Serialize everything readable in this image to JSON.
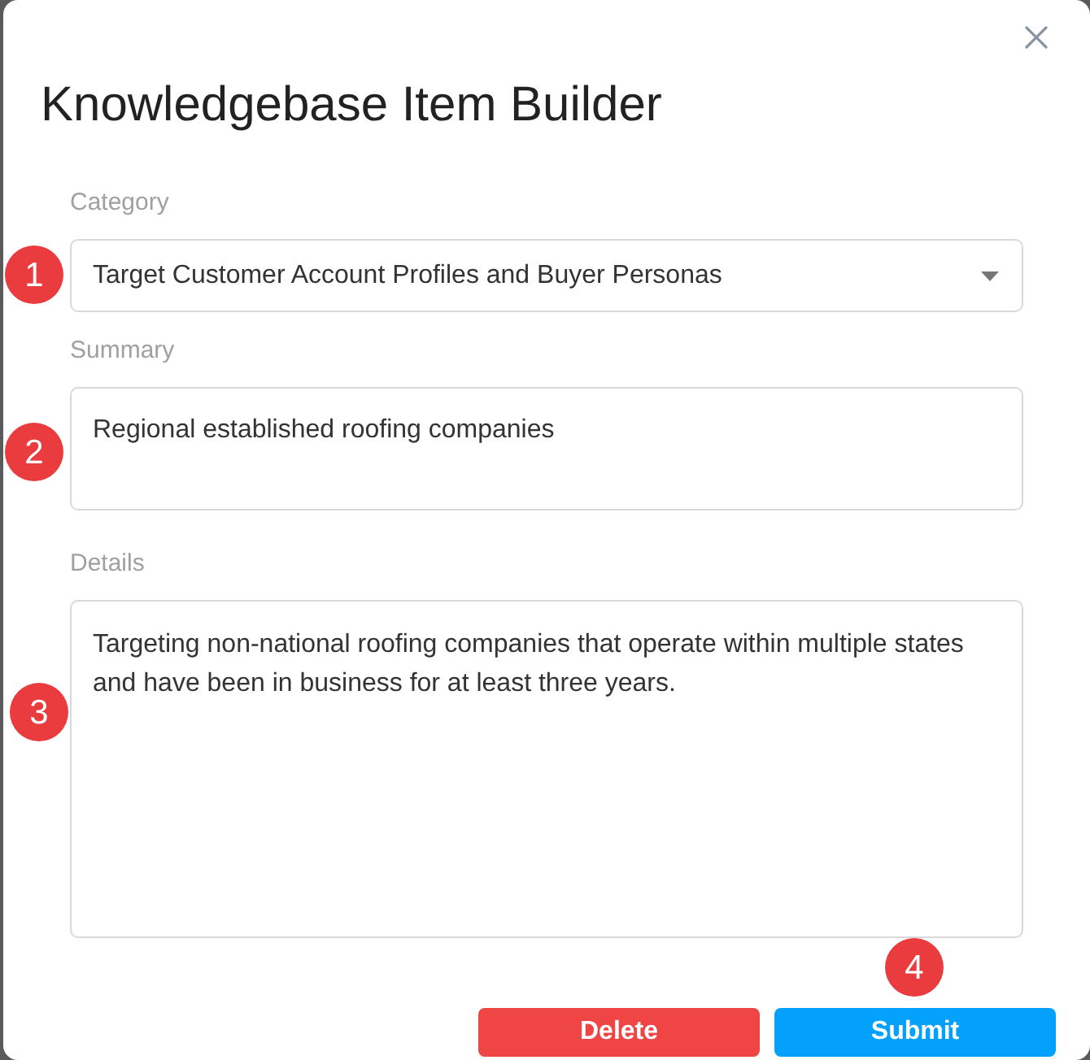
{
  "dialog": {
    "title": "Knowledgebase Item Builder"
  },
  "fields": [
    {
      "kind": "select",
      "label": "Category",
      "value": "Target Customer Account Profiles and Buyer Personas",
      "marker": "1"
    },
    {
      "kind": "text",
      "label": "Summary",
      "value": "Regional established roofing companies",
      "marker": "2"
    },
    {
      "kind": "textarea",
      "label": "Details",
      "value": "Targeting non-national roofing companies that operate within multiple states and have been in business for at least three years.",
      "marker": "3"
    }
  ],
  "buttons": [
    {
      "kind": "danger",
      "label": "Delete"
    },
    {
      "kind": "primary",
      "label": "Submit",
      "marker": "4"
    }
  ]
}
